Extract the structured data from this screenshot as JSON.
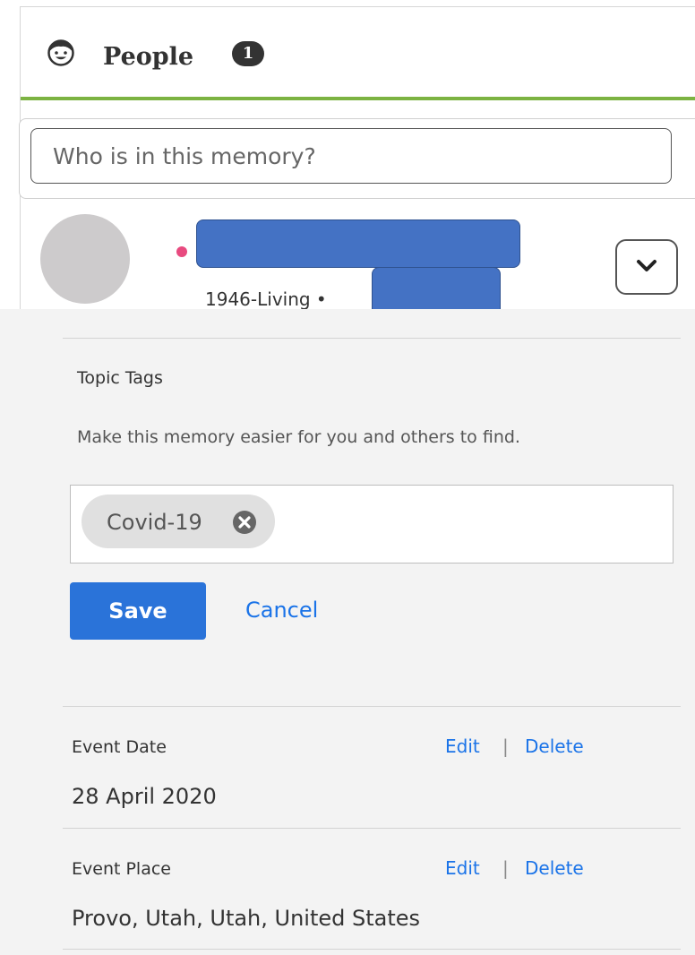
{
  "people": {
    "title": "People",
    "count": "1",
    "search": {
      "placeholder": "Who is in this memory?"
    },
    "person": {
      "lifespan": "1946-Living •"
    }
  },
  "topic_tags": {
    "heading": "Topic Tags",
    "helper_text": "Make this memory easier for you and others to find.",
    "tags": [
      {
        "label": "Covid-19"
      }
    ],
    "save_label": "Save",
    "cancel_label": "Cancel"
  },
  "event_date": {
    "label": "Event Date",
    "value": "28 April 2020",
    "edit_label": "Edit",
    "separator": "|",
    "delete_label": "Delete"
  },
  "event_place": {
    "label": "Event Place",
    "value": "Provo, Utah, Utah, United States",
    "edit_label": "Edit",
    "separator": "|",
    "delete_label": "Delete"
  },
  "colors": {
    "accent_green": "#7cb342",
    "link_blue": "#1a73e8",
    "button_blue": "#2a73d9",
    "status_dot": "#e84a7f",
    "redaction_blue": "#4472c4"
  },
  "icons": {
    "people_header": "face-icon",
    "tag_remove": "remove-tag-icon",
    "expand": "chevron-down-icon"
  }
}
